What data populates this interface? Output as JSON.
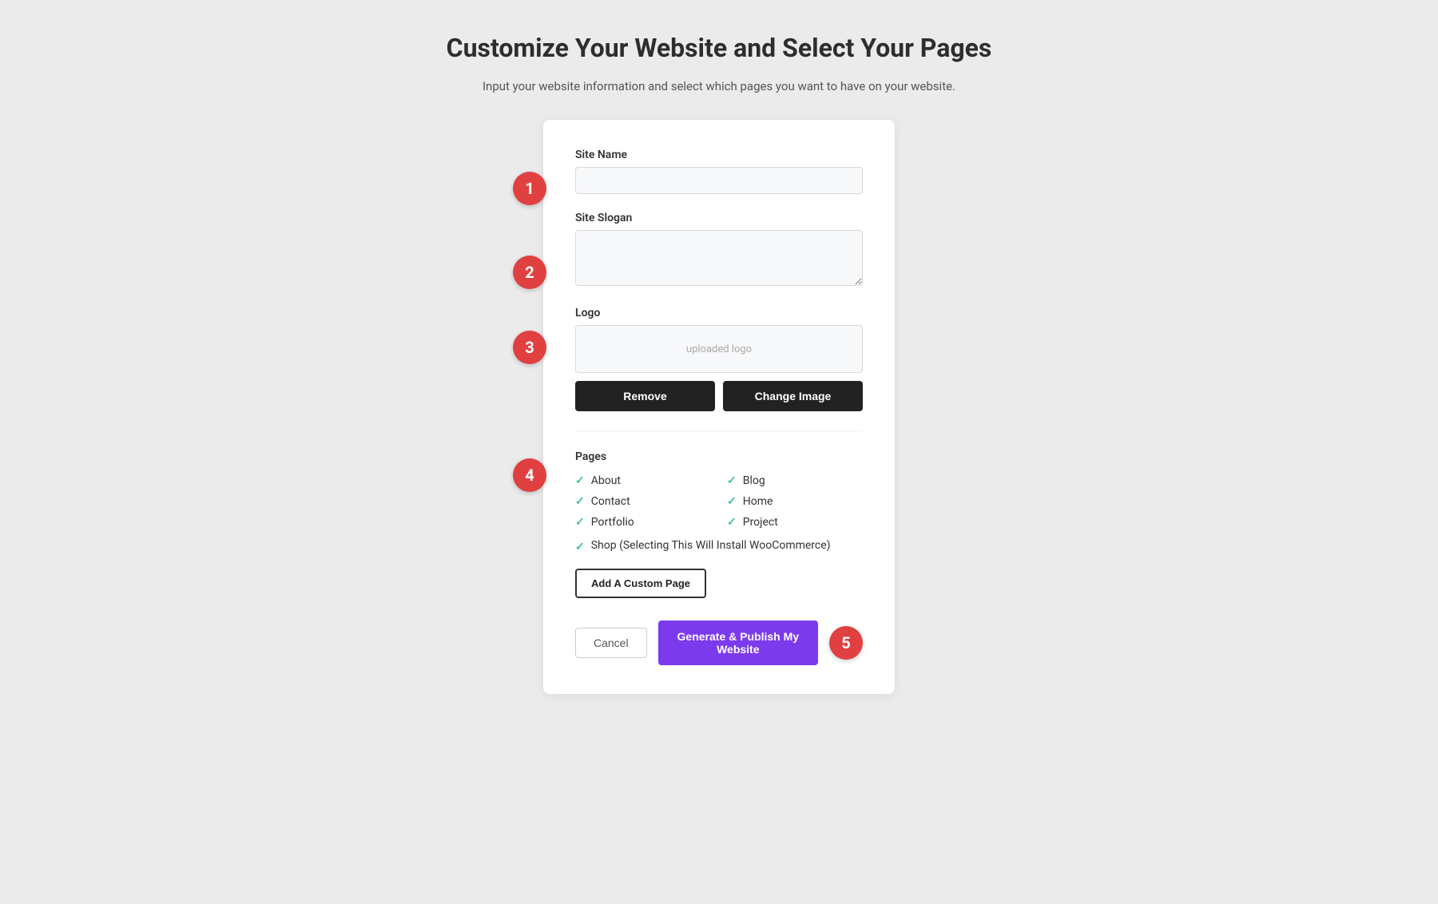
{
  "header": {
    "title": "Customize Your Website and Select Your Pages",
    "subtitle": "Input your website information and select which pages you want to have on your website."
  },
  "form": {
    "site_name": {
      "label": "Site Name",
      "placeholder": "",
      "value": ""
    },
    "site_slogan": {
      "label": "Site Slogan",
      "placeholder": "",
      "value": ""
    },
    "logo": {
      "label": "Logo",
      "preview_text": "uploaded logo",
      "remove_btn": "Remove",
      "change_btn": "Change Image"
    },
    "pages": {
      "label": "Pages",
      "items_col1": [
        {
          "name": "About",
          "checked": true
        },
        {
          "name": "Contact",
          "checked": true
        },
        {
          "name": "Portfolio",
          "checked": true
        }
      ],
      "items_col2": [
        {
          "name": "Blog",
          "checked": true
        },
        {
          "name": "Home",
          "checked": true
        },
        {
          "name": "Project",
          "checked": true
        }
      ],
      "shop": {
        "name": "Shop (Selecting This Will Install WooCommerce)",
        "checked": true
      },
      "add_custom_btn": "Add A Custom Page"
    },
    "footer": {
      "cancel_btn": "Cancel",
      "publish_btn": "Generate & Publish My Website"
    }
  },
  "steps": {
    "step1": "1",
    "step2": "2",
    "step3": "3",
    "step4": "4",
    "step5": "5"
  }
}
